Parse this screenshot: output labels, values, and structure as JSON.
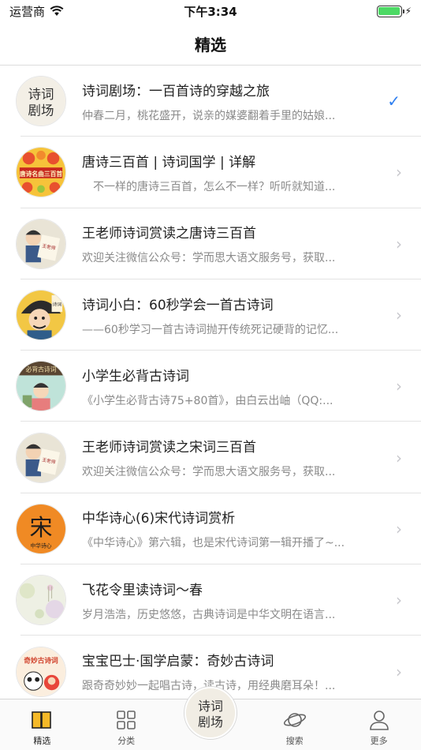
{
  "status_bar": {
    "carrier": "运营商",
    "time": "下午3:34",
    "battery_level": 1.0
  },
  "nav": {
    "title": "精选"
  },
  "list": [
    {
      "title": "诗词剧场：一百首诗的穿越之旅",
      "desc": "仲春二月，桃花盛开，说亲的媒婆翻着手里的姑娘...",
      "avatar": "poetry-theater-logo",
      "accessory": "checkmark-icon",
      "selected": true
    },
    {
      "title": "唐诗三百首 | 诗词国学 | 详解",
      "desc": "　不一样的唐诗三百首，怎么不一样？听听就知道...",
      "avatar": "tang-poems-cover",
      "accessory": "chevron-right-icon",
      "selected": false
    },
    {
      "title": "王老师诗词赏读之唐诗三百首",
      "desc": "欢迎关注微信公众号：学而思大语文服务号，获取...",
      "avatar": "teacher-wang-cover",
      "accessory": "chevron-right-icon",
      "selected": false
    },
    {
      "title": "诗词小白：60秒学会一首古诗词",
      "desc": "——60秒学习一首古诗词抛开传统死记硬背的记忆...",
      "avatar": "poetry-beginner-cover",
      "accessory": "chevron-right-icon",
      "selected": false
    },
    {
      "title": "小学生必背古诗词",
      "desc": "《小学生必背古诗75+80首》，由白云出岫（QQ:...",
      "avatar": "pupil-poems-cover",
      "accessory": "chevron-right-icon",
      "selected": false
    },
    {
      "title": "王老师诗词赏读之宋词三百首",
      "desc": "欢迎关注微信公众号：学而思大语文服务号，获取...",
      "avatar": "teacher-wang-cover",
      "accessory": "chevron-right-icon",
      "selected": false
    },
    {
      "title": "中华诗心(6)宋代诗词赏析",
      "desc": "《中华诗心》第六辑，也是宋代诗词第一辑开播了~...",
      "avatar": "song-dynasty-cover",
      "accessory": "chevron-right-icon",
      "selected": false
    },
    {
      "title": "飞花令里读诗词～春",
      "desc": "岁月浩浩，历史悠悠，古典诗词是中华文明在语言...",
      "avatar": "spring-flowers-cover",
      "accessory": "chevron-right-icon",
      "selected": false
    },
    {
      "title": "宝宝巴士·国学启蒙：奇妙古诗词",
      "desc": "跟奇奇妙妙一起唱古诗，读古诗，用经典磨耳朵！...",
      "avatar": "babybus-cover",
      "accessory": "chevron-right-icon",
      "selected": false
    }
  ],
  "avatar_text": {
    "poetry_theater": [
      "诗词",
      "剧场"
    ],
    "tang_poems": "唐诗名曲三百首",
    "teacher_wang": "王老师",
    "poetry_beginner": "诗词",
    "pupil_poems": "必背古诗词",
    "song_dynasty": "宋",
    "song_dynasty_sub": "中华诗心",
    "babybus": "奇妙古诗词"
  },
  "tabs": [
    {
      "label": "精选",
      "icon": "book-icon",
      "active": true
    },
    {
      "label": "分类",
      "icon": "grid-icon",
      "active": false
    },
    {
      "label": "",
      "icon": "poetry-theater-center-icon",
      "active": false
    },
    {
      "label": "搜索",
      "icon": "planet-search-icon",
      "active": false
    },
    {
      "label": "更多",
      "icon": "person-icon",
      "active": false
    }
  ],
  "colors": {
    "accent_blue": "#2f7ff0",
    "battery_green": "#4cd964",
    "desc_gray": "#8a8a8a"
  }
}
